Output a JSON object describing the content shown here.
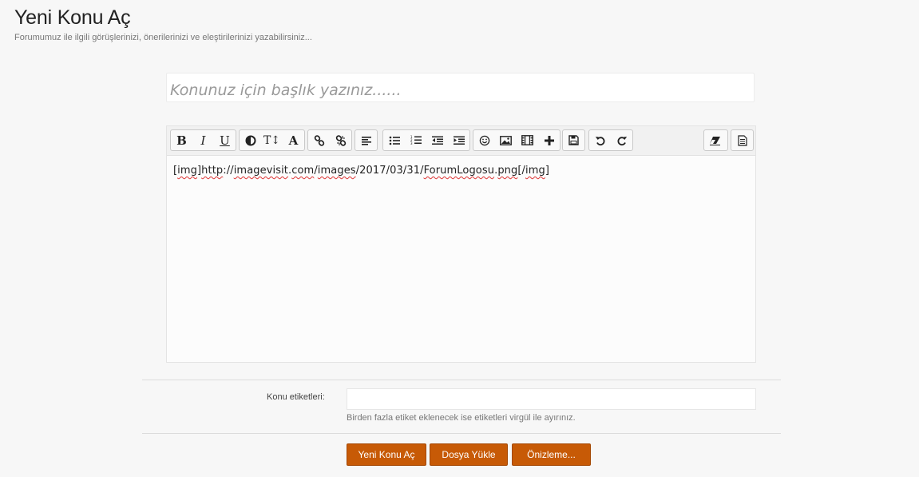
{
  "header": {
    "title": "Yeni Konu Aç",
    "subtitle": "Forumumuz ile ilgili görüşlerinizi, önerilerinizi ve eleştirilerinizi yazabilirsiniz..."
  },
  "title_field": {
    "placeholder": "Konunuz için başlık yazınız......",
    "value": ""
  },
  "toolbar": {
    "bold": "B",
    "italic": "I",
    "underline": "U",
    "font_size": "T↕",
    "font_color": "A",
    "icons": [
      "bold-icon",
      "italic-icon",
      "underline-icon",
      "font-family-icon",
      "font-size-icon",
      "font-color-icon",
      "link-icon",
      "unlink-icon",
      "align-left-icon",
      "bullet-list-icon",
      "numbered-list-icon",
      "outdent-icon",
      "indent-icon",
      "smiley-icon",
      "image-icon",
      "video-icon",
      "more-icon",
      "save-icon",
      "undo-icon",
      "redo-icon",
      "eraser-icon",
      "source-icon"
    ]
  },
  "editor": {
    "parts": [
      "[",
      "img",
      "]",
      "http",
      "://",
      "imagevisit",
      ".",
      "com",
      "/",
      "images",
      "/2017/03/31/",
      "ForumLogosu",
      ".",
      "png",
      "[/",
      "img",
      "]"
    ]
  },
  "tags": {
    "label": "Konu etiketleri:",
    "value": "",
    "hint": "Birden fazla etiket eklenecek ise etiketleri virgül ile ayırınız."
  },
  "buttons": {
    "new_topic": "Yeni Konu Aç",
    "upload": "Dosya Yükle",
    "preview": "Önizleme..."
  },
  "colors": {
    "accent": "#c75a06",
    "background": "#f7f7f7"
  }
}
